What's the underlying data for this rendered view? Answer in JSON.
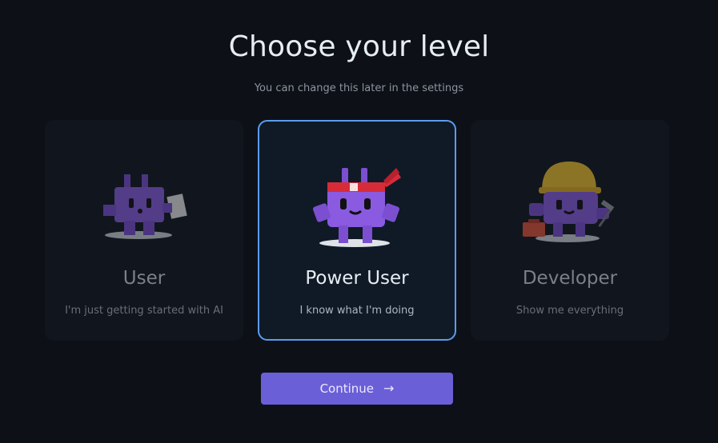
{
  "header": {
    "title": "Choose your level",
    "subtitle": "You can change this later in the settings"
  },
  "levels": [
    {
      "label": "User",
      "description": "I'm just getting started with AI",
      "selected": false,
      "mascot_icon": "mascot-with-paper-icon"
    },
    {
      "label": "Power User",
      "description": "I know what I'm doing",
      "selected": true,
      "mascot_icon": "mascot-with-headband-icon"
    },
    {
      "label": "Developer",
      "description": "Show me everything",
      "selected": false,
      "mascot_icon": "mascot-with-hardhat-icon"
    }
  ],
  "footer": {
    "continue_label": "Continue",
    "continue_icon": "arrow-right-icon"
  },
  "colors": {
    "background": "#0d1117",
    "selected_border": "#5b9cf0",
    "button": "#6b5fd8",
    "mascot_purple": "#7b4fd0"
  }
}
